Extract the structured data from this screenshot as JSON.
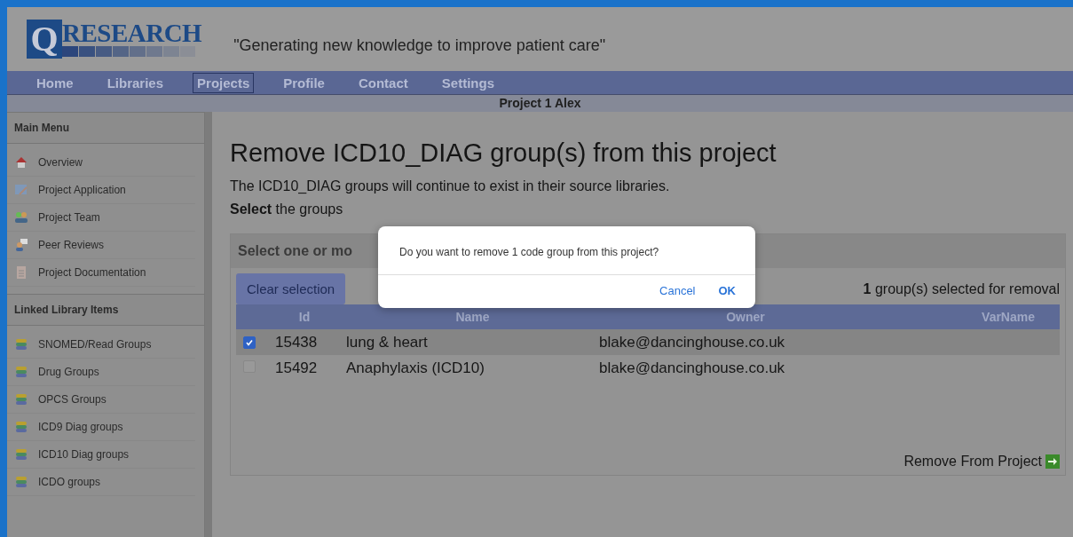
{
  "header": {
    "logo": {
      "letter": "Q",
      "text": "RESEARCH"
    },
    "tagline": "\"Generating new knowledge to improve patient care\""
  },
  "nav": [
    {
      "label": "Home",
      "selected": false
    },
    {
      "label": "Libraries",
      "selected": false
    },
    {
      "label": "Projects",
      "selected": true
    },
    {
      "label": "Profile",
      "selected": false
    },
    {
      "label": "Contact",
      "selected": false
    },
    {
      "label": "Settings",
      "selected": false
    }
  ],
  "project_bar": {
    "title": "Project 1 Alex"
  },
  "sidebar": {
    "sections": [
      {
        "title": "Main Menu",
        "items": [
          {
            "label": "Overview",
            "kind": "house"
          },
          {
            "label": "Project Application",
            "kind": "form"
          },
          {
            "label": "Project Team",
            "kind": "team"
          },
          {
            "label": "Peer Reviews",
            "kind": "review"
          },
          {
            "label": "Project Documentation",
            "kind": "document"
          }
        ]
      },
      {
        "title": "Linked Library Items",
        "items": [
          {
            "label": "SNOMED/Read Groups",
            "kind": "library"
          },
          {
            "label": "Drug Groups",
            "kind": "library"
          },
          {
            "label": "OPCS Groups",
            "kind": "library"
          },
          {
            "label": "ICD9 Diag groups",
            "kind": "library"
          },
          {
            "label": "ICD10 Diag groups",
            "kind": "library"
          },
          {
            "label": "ICDO groups",
            "kind": "library"
          }
        ]
      }
    ]
  },
  "main": {
    "title": "Remove ICD10_DIAG group(s) from this project",
    "description": "The ICD10_DIAG groups will continue to exist in their source libraries.",
    "instruction": "**Select** the groups",
    "panel": {
      "title": "Select one or mo",
      "clear_button": "Clear selection",
      "selection_count": "**1** group(s) selected for removal",
      "columns": [
        "Id",
        "Name",
        "Owner",
        "VarName"
      ],
      "rows": [
        {
          "checked": true,
          "selected": true,
          "id": "15438",
          "name": "lung & heart",
          "owner": "blake@dancinghouse.co.uk"
        },
        {
          "checked": false,
          "selected": false,
          "id": "15492",
          "name": "Anaphylaxis (ICD10)",
          "owner": "blake@dancinghouse.co.uk"
        }
      ],
      "action": "Remove From Project"
    }
  },
  "dialog": {
    "message": "Do you want to remove 1 code group from this project?",
    "buttons": [
      "Cancel",
      "OK"
    ]
  }
}
